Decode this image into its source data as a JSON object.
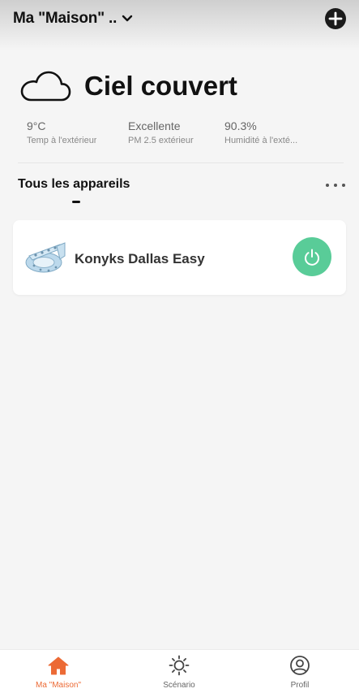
{
  "header": {
    "home_name": "Ma \"Maison\" ..",
    "icons": {
      "chevron": "chevron-down-icon",
      "add": "plus-icon"
    }
  },
  "weather": {
    "icon": "cloud-icon",
    "condition": "Ciel couvert",
    "metrics": [
      {
        "value": "9°C",
        "label": "Temp à l'extérieur"
      },
      {
        "value": "Excellente",
        "label": "PM 2.5 extérieur"
      },
      {
        "value": "90.3%",
        "label": "Humidité à l'exté..."
      }
    ]
  },
  "devices_section": {
    "tab_label": "Tous les appareils",
    "more_icon": "more-horizontal-icon"
  },
  "devices": [
    {
      "name": "Konyks Dallas Easy",
      "icon": "led-strip-thumbnail",
      "power_color": "#59cc98"
    }
  ],
  "bottom_nav": [
    {
      "label": "Ma \"Maison\"",
      "icon": "home-icon",
      "active": true
    },
    {
      "label": "Scénario",
      "icon": "sun-icon",
      "active": false
    },
    {
      "label": "Profil",
      "icon": "profile-icon",
      "active": false
    }
  ],
  "colors": {
    "accent": "#ec6a35",
    "power_on": "#59cc98",
    "background": "#f5f5f5"
  }
}
